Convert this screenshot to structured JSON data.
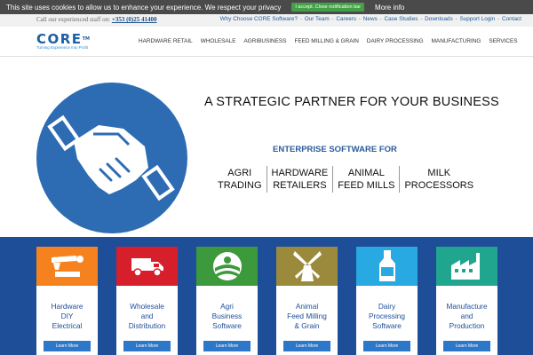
{
  "cookie": {
    "text": "This site uses cookies to allow us to enhance your experience. We respect your privacy",
    "accept": "I accept. Close notification bar",
    "more": "More info"
  },
  "topbar": {
    "call_text": "Call our experienced staff on:",
    "phone": "+353 (0)25 41400",
    "links": [
      "Why Choose CORE Software?",
      "Our Team",
      "Careers",
      "News",
      "Case Studies",
      "Downloads",
      "Support Login",
      "Contact"
    ]
  },
  "logo": {
    "name": "CORE",
    "tm": "TM",
    "tagline": "Turning Experience Into Profit"
  },
  "nav": [
    "HARDWARE RETAIL",
    "WHOLESALE",
    "AGRIBUSINESS",
    "FEED MILLING & GRAIN",
    "DAIRY PROCESSING",
    "MANUFACTURING",
    "SERVICES"
  ],
  "hero": {
    "title": "A STRATEGIC PARTNER FOR YOUR BUSINESS",
    "subtitle": "ENTERPRISE SOFTWARE FOR",
    "categories": [
      {
        "line1": "AGRI",
        "line2": "TRADING"
      },
      {
        "line1": "HARDWARE",
        "line2": "RETAILERS"
      },
      {
        "line1": "ANIMAL",
        "line2": "FEED MILLS"
      },
      {
        "line1": "MILK",
        "line2": "PROCESSORS"
      }
    ]
  },
  "boxes": [
    {
      "lines": [
        "Hardware",
        "DIY",
        "Electrical"
      ],
      "button": "Learn More",
      "color": "#f5821f",
      "icon": "tools-icon"
    },
    {
      "lines": [
        "Wholesale",
        "and",
        "Distribution"
      ],
      "button": "Learn More",
      "color": "#d71e2b",
      "icon": "van-icon"
    },
    {
      "lines": [
        "Agri",
        "Business",
        "Software"
      ],
      "button": "Learn More",
      "color": "#3c9a3c",
      "icon": "field-icon"
    },
    {
      "lines": [
        "Animal",
        "Feed Milling",
        "& Grain"
      ],
      "button": "Learn More",
      "color": "#9c8a3c",
      "icon": "windmill-icon"
    },
    {
      "lines": [
        "Dairy",
        "Processing",
        "Software"
      ],
      "button": "Learn More",
      "color": "#29a9e1",
      "icon": "milk-bottle-icon"
    },
    {
      "lines": [
        "Manufacture",
        "and",
        "Production"
      ],
      "button": "Learn More",
      "color": "#20a58f",
      "icon": "factory-icon"
    }
  ]
}
